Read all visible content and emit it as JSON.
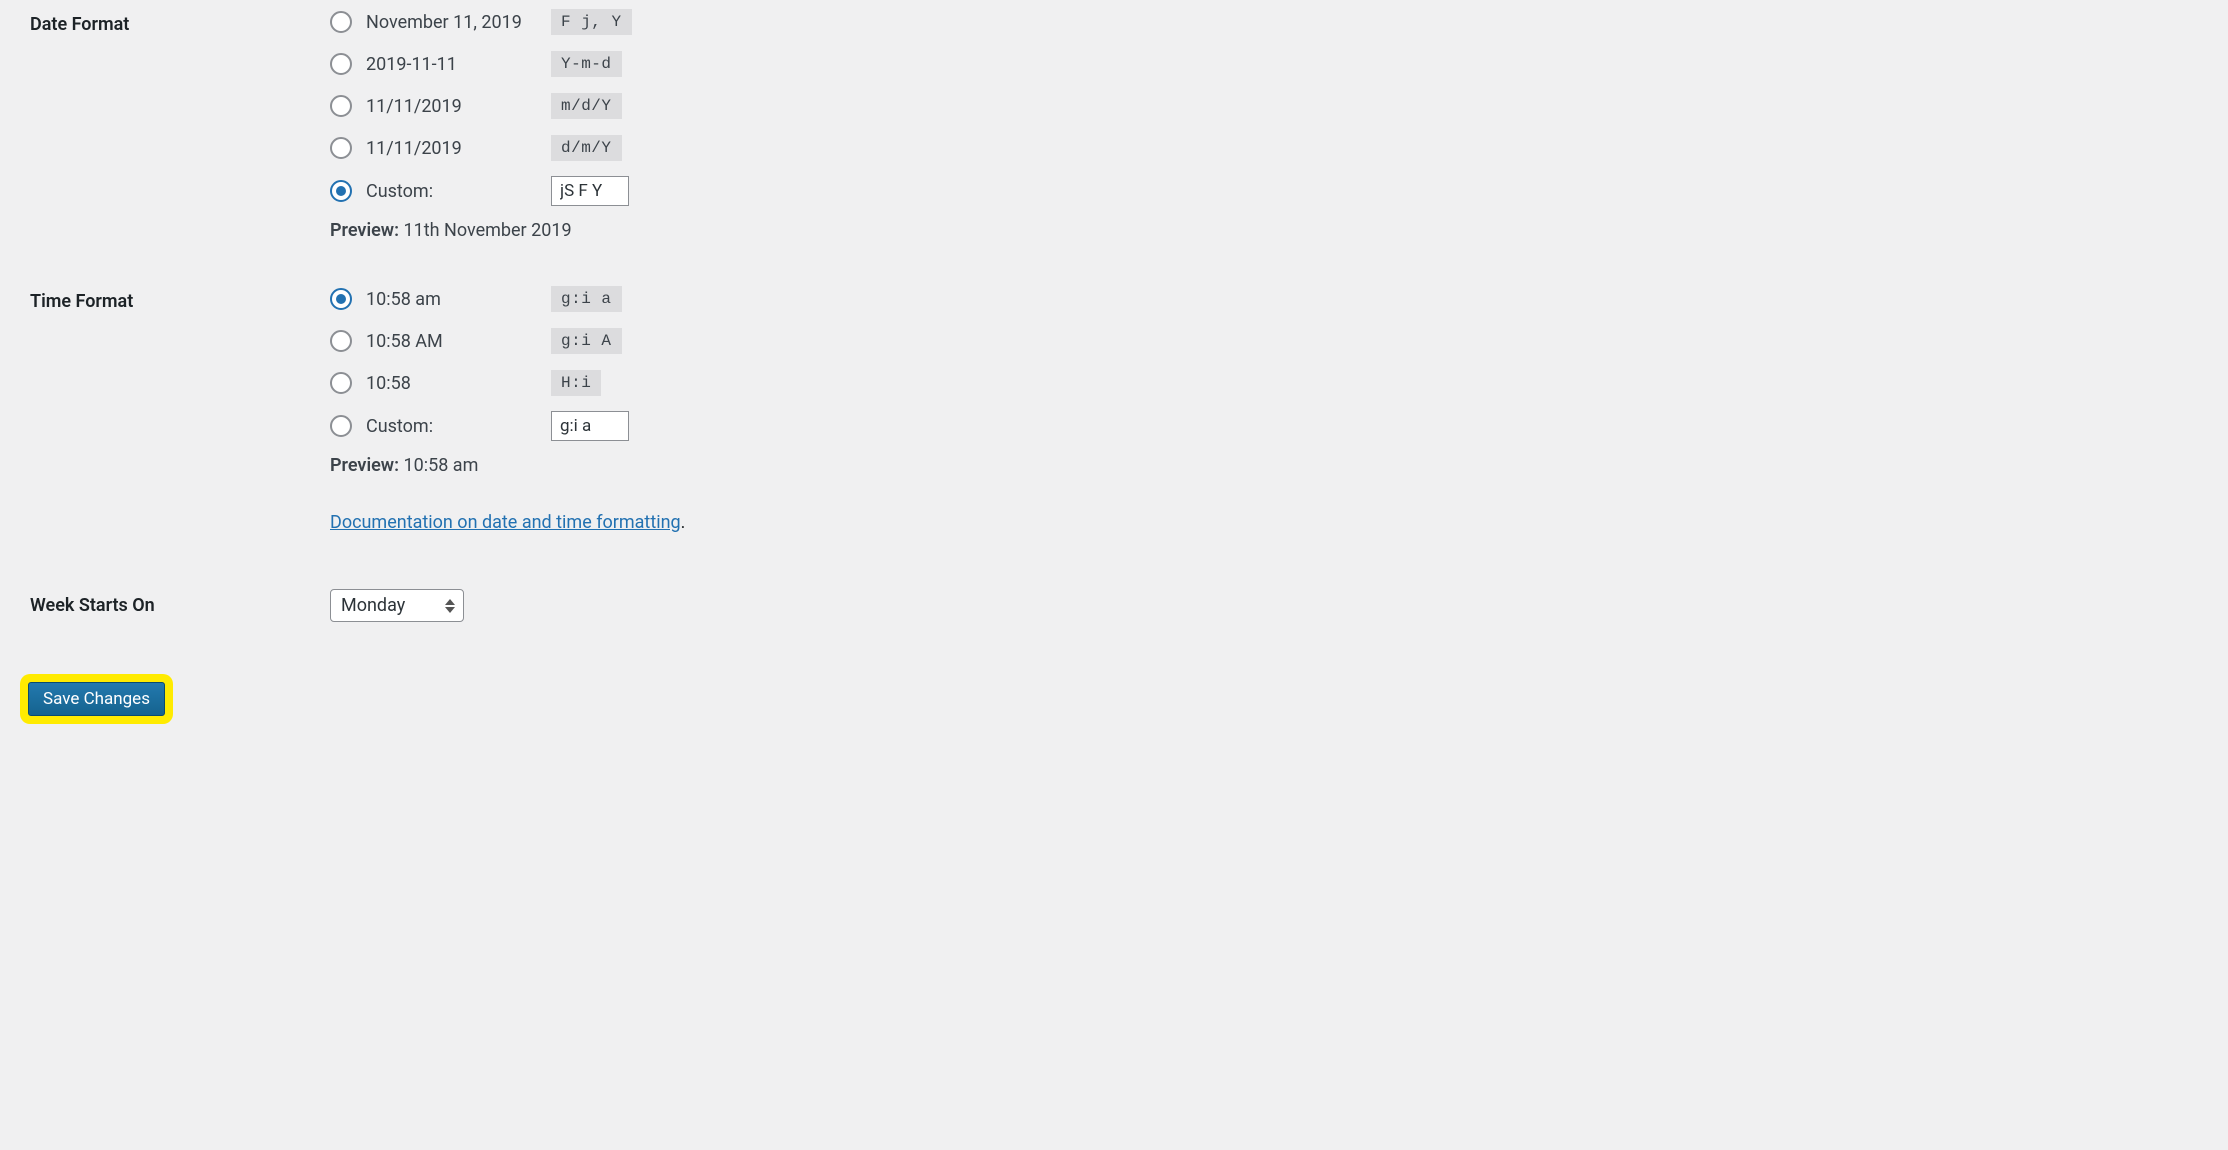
{
  "date_format": {
    "heading": "Date Format",
    "options": [
      {
        "label": "November 11, 2019",
        "code": "F j, Y",
        "checked": false
      },
      {
        "label": "2019-11-11",
        "code": "Y-m-d",
        "checked": false
      },
      {
        "label": "11/11/2019",
        "code": "m/d/Y",
        "checked": false
      },
      {
        "label": "11/11/2019",
        "code": "d/m/Y",
        "checked": false
      }
    ],
    "custom_label": "Custom:",
    "custom_checked": true,
    "custom_value": "jS F Y",
    "preview_label": "Preview:",
    "preview_value": "11th November 2019"
  },
  "time_format": {
    "heading": "Time Format",
    "options": [
      {
        "label": "10:58 am",
        "code": "g:i a",
        "checked": true
      },
      {
        "label": "10:58 AM",
        "code": "g:i A",
        "checked": false
      },
      {
        "label": "10:58",
        "code": "H:i",
        "checked": false
      }
    ],
    "custom_label": "Custom:",
    "custom_checked": false,
    "custom_value": "g:i a",
    "preview_label": "Preview:",
    "preview_value": "10:58 am",
    "doc_link": "Documentation on date and time formatting",
    "doc_link_suffix": "."
  },
  "week_starts": {
    "heading": "Week Starts On",
    "selected": "Monday"
  },
  "submit": {
    "label": "Save Changes"
  }
}
